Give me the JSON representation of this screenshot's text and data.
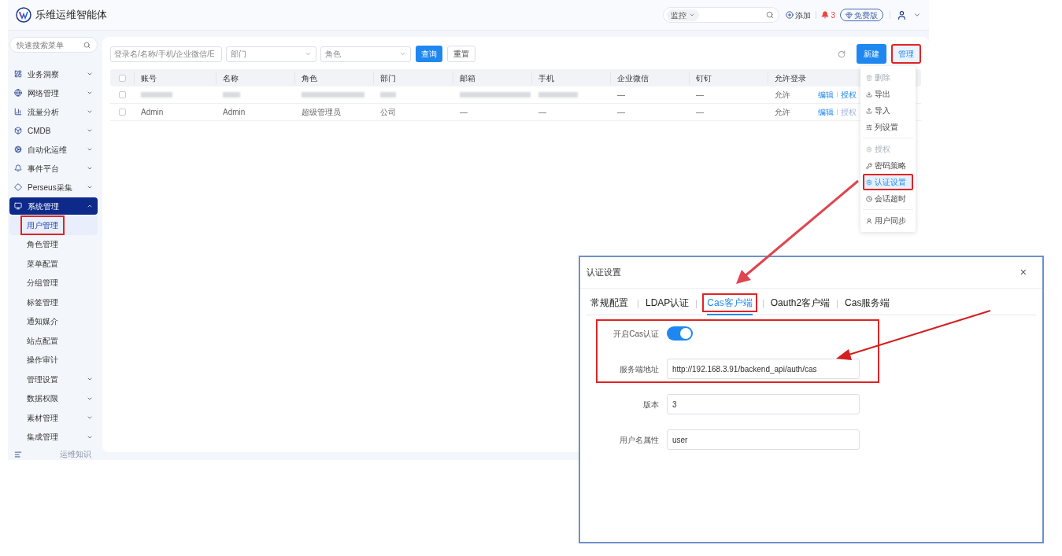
{
  "header": {
    "title": "乐维运维智能体",
    "scope_select": {
      "value": "监控"
    },
    "add_label": "添加",
    "alert_count": "3",
    "plan_badge": "免费版"
  },
  "sidebar": {
    "search": {
      "placeholder": "快速搜索菜单"
    },
    "items": [
      {
        "label": "业务洞察",
        "expanded": false,
        "selected": false
      },
      {
        "label": "网络管理",
        "expanded": false,
        "selected": false
      },
      {
        "label": "流量分析",
        "expanded": false,
        "selected": false
      },
      {
        "label": "CMDB",
        "expanded": false,
        "selected": false
      },
      {
        "label": "自动化运维",
        "expanded": false,
        "selected": false
      },
      {
        "label": "事件平台",
        "expanded": false,
        "selected": false
      },
      {
        "label": "Perseus采集",
        "expanded": false,
        "selected": false
      },
      {
        "label": "系统管理",
        "expanded": true,
        "selected": true,
        "children": [
          {
            "label": "用户管理",
            "selected": true,
            "has_children": false,
            "annotated": true
          },
          {
            "label": "角色管理",
            "selected": false,
            "has_children": false,
            "annotated": false
          },
          {
            "label": "菜单配置",
            "selected": false,
            "has_children": false,
            "annotated": false
          },
          {
            "label": "分组管理",
            "selected": false,
            "has_children": false,
            "annotated": false
          },
          {
            "label": "标签管理",
            "selected": false,
            "has_children": false,
            "annotated": false
          },
          {
            "label": "通知媒介",
            "selected": false,
            "has_children": false,
            "annotated": false
          },
          {
            "label": "站点配置",
            "selected": false,
            "has_children": false,
            "annotated": false
          },
          {
            "label": "操作审计",
            "selected": false,
            "has_children": false,
            "annotated": false
          },
          {
            "label": "管理设置",
            "selected": false,
            "has_children": true,
            "annotated": false
          },
          {
            "label": "数据权限",
            "selected": false,
            "has_children": true,
            "annotated": false
          },
          {
            "label": "素材管理",
            "selected": false,
            "has_children": true,
            "annotated": false
          },
          {
            "label": "集成管理",
            "selected": false,
            "has_children": true,
            "annotated": false
          }
        ]
      }
    ],
    "footer_label": "运维知识"
  },
  "filters": {
    "keyword": {
      "placeholder": "登录名/名称/手机/企业微信/E"
    },
    "department": {
      "placeholder": "部门"
    },
    "role": {
      "placeholder": "角色"
    },
    "buttons": [
      "查询",
      "重置"
    ]
  },
  "toolbar": {
    "buttons": [
      {
        "label": "新建",
        "annotated": false
      },
      {
        "label": "管理",
        "annotated": true
      }
    ]
  },
  "table": {
    "all_checked": false,
    "columns": [
      "账号",
      "名称",
      "角色",
      "部门",
      "邮箱",
      "手机",
      "企业微信",
      "钉钉",
      "允许登录"
    ],
    "rows": [
      {
        "checked": false,
        "cells": [
          {
            "kind": "blurred"
          },
          {
            "kind": "blurred"
          },
          {
            "kind": "blurred"
          },
          {
            "kind": "blurred"
          },
          {
            "kind": "blurred"
          },
          {
            "kind": "blurred"
          },
          {
            "kind": "text",
            "text": "—"
          },
          {
            "kind": "text",
            "text": "—"
          },
          {
            "kind": "text",
            "text": "允许"
          }
        ],
        "actions": [
          {
            "label": "编辑",
            "disabled": false
          },
          {
            "label": "授权",
            "disabled": false
          }
        ]
      },
      {
        "checked": false,
        "cells": [
          {
            "kind": "text",
            "text": "Admin"
          },
          {
            "kind": "text",
            "text": "Admin"
          },
          {
            "kind": "text",
            "text": "超级管理员"
          },
          {
            "kind": "text",
            "text": "公司"
          },
          {
            "kind": "text",
            "text": "—"
          },
          {
            "kind": "text",
            "text": "—"
          },
          {
            "kind": "text",
            "text": "—"
          },
          {
            "kind": "text",
            "text": "—"
          },
          {
            "kind": "text",
            "text": "允许"
          }
        ],
        "actions": [
          {
            "label": "编辑",
            "disabled": false
          },
          {
            "label": "授权",
            "disabled": true
          }
        ]
      }
    ]
  },
  "manage_menu": {
    "groups": [
      [
        {
          "label": "删除",
          "disabled": true,
          "selected": false,
          "annotated": false
        },
        {
          "label": "导出",
          "disabled": false,
          "selected": false,
          "annotated": false
        },
        {
          "label": "导入",
          "disabled": false,
          "selected": false,
          "annotated": false
        },
        {
          "label": "列设置",
          "disabled": false,
          "selected": false,
          "annotated": false
        }
      ],
      [
        {
          "label": "授权",
          "disabled": true,
          "selected": false,
          "annotated": false
        },
        {
          "label": "密码策略",
          "disabled": false,
          "selected": false,
          "annotated": false
        },
        {
          "label": "认证设置",
          "disabled": false,
          "selected": true,
          "annotated": true
        },
        {
          "label": "会话超时",
          "disabled": false,
          "selected": false,
          "annotated": false
        }
      ],
      [
        {
          "label": "用户同步",
          "disabled": false,
          "selected": false,
          "annotated": false
        }
      ]
    ]
  },
  "dialog": {
    "title": "认证设置",
    "close": "×",
    "tabs": [
      {
        "label": "常规配置",
        "selected": false,
        "annotated": false
      },
      {
        "label": "LDAP认证",
        "selected": false,
        "annotated": false
      },
      {
        "label": "Cas客户端",
        "selected": true,
        "annotated": true
      },
      {
        "label": "Oauth2客户端",
        "selected": false,
        "annotated": false
      },
      {
        "label": "Cas服务端",
        "selected": false,
        "annotated": false
      }
    ],
    "field_groups": [
      {
        "annotated": true,
        "fields": [
          {
            "kind": "toggle",
            "label": "开启Cas认证",
            "on": true
          },
          {
            "kind": "input",
            "label": "服务端地址",
            "value": "http://192.168.3.91/backend_api/auth/cas"
          }
        ]
      },
      {
        "annotated": false,
        "fields": [
          {
            "kind": "input",
            "label": "版本",
            "value": "3"
          },
          {
            "kind": "input",
            "label": "用户名属性",
            "value": "user"
          }
        ]
      }
    ]
  }
}
